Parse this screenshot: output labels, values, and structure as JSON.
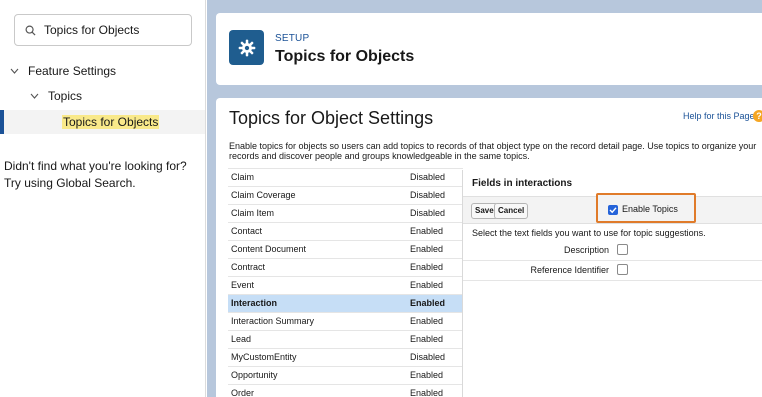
{
  "sidebar": {
    "search_value": "Topics for Objects",
    "tree": {
      "feature_settings": "Feature Settings",
      "topics": "Topics",
      "selected_item": "Topics for Objects"
    },
    "help_line1": "Didn't find what you're looking for?",
    "help_line2": "Try using Global Search."
  },
  "header": {
    "setup_label": "SETUP",
    "title": "Topics for Objects"
  },
  "content": {
    "page_title": "Topics for Object Settings",
    "help_link": "Help for this Page",
    "description": "Enable topics for objects so users can add topics to records of that object type on the record detail page. Use topics to organize your records and discover people and groups knowledgeable in the same topics.",
    "objects": [
      {
        "name": "Claim",
        "status": "Disabled"
      },
      {
        "name": "Claim Coverage",
        "status": "Disabled"
      },
      {
        "name": "Claim Item",
        "status": "Disabled"
      },
      {
        "name": "Contact",
        "status": "Enabled"
      },
      {
        "name": "Content Document",
        "status": "Enabled"
      },
      {
        "name": "Contract",
        "status": "Enabled"
      },
      {
        "name": "Event",
        "status": "Enabled"
      },
      {
        "name": "Interaction",
        "status": "Enabled"
      },
      {
        "name": "Interaction Summary",
        "status": "Enabled"
      },
      {
        "name": "Lead",
        "status": "Enabled"
      },
      {
        "name": "MyCustomEntity",
        "status": "Disabled"
      },
      {
        "name": "Opportunity",
        "status": "Enabled"
      },
      {
        "name": "Order",
        "status": "Enabled"
      }
    ],
    "selected_object": "Interaction",
    "fields_panel": {
      "title": "Fields in interactions",
      "save_label": "Save",
      "cancel_label": "Cancel",
      "enable_topics_label": "Enable Topics",
      "enable_topics_checked": true,
      "select_hint": "Select the text fields you want to use for topic suggestions.",
      "fields": [
        {
          "label": "Description",
          "checked": false
        },
        {
          "label": "Reference Identifier",
          "checked": false
        }
      ]
    }
  },
  "colors": {
    "brand_blue": "#1b5297",
    "highlight_orange": "#e07b2a",
    "selected_row": "#c6def6",
    "background": "#b7c7dc"
  }
}
